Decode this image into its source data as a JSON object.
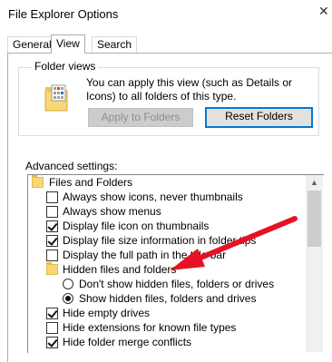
{
  "window": {
    "title": "File Explorer Options",
    "close_glyph": "✕"
  },
  "tabs": [
    {
      "label": "General",
      "active": false
    },
    {
      "label": "View",
      "active": true
    },
    {
      "label": "Search",
      "active": false
    }
  ],
  "folder_views": {
    "group_label": "Folder views",
    "description": "You can apply this view (such as Details or Icons) to all folders of this type.",
    "apply_button": "Apply to Folders",
    "reset_button": "Reset Folders"
  },
  "advanced": {
    "label": "Advanced settings:",
    "items": [
      {
        "type": "folder",
        "label": "Files and Folders"
      },
      {
        "type": "checkbox",
        "label": "Always show icons, never thumbnails",
        "checked": false
      },
      {
        "type": "checkbox",
        "label": "Always show menus",
        "checked": false
      },
      {
        "type": "checkbox",
        "label": "Display file icon on thumbnails",
        "checked": true
      },
      {
        "type": "checkbox",
        "label": "Display file size information in folder tips",
        "checked": true
      },
      {
        "type": "checkbox",
        "label": "Display the full path in the title bar",
        "checked": false
      },
      {
        "type": "folder",
        "label": "Hidden files and folders"
      },
      {
        "type": "radio",
        "label": "Don't show hidden files, folders or drives",
        "checked": false
      },
      {
        "type": "radio",
        "label": "Show hidden files, folders and drives",
        "checked": true
      },
      {
        "type": "checkbox",
        "label": "Hide empty drives",
        "checked": true
      },
      {
        "type": "checkbox",
        "label": "Hide extensions for known file types",
        "checked": false
      },
      {
        "type": "checkbox",
        "label": "Hide folder merge conflicts",
        "checked": true
      }
    ]
  },
  "colors": {
    "accent": "#0078d7",
    "annotation_arrow": "#e81123",
    "folder": "#f8d775"
  },
  "icons": {
    "scroll_up": "▲"
  }
}
